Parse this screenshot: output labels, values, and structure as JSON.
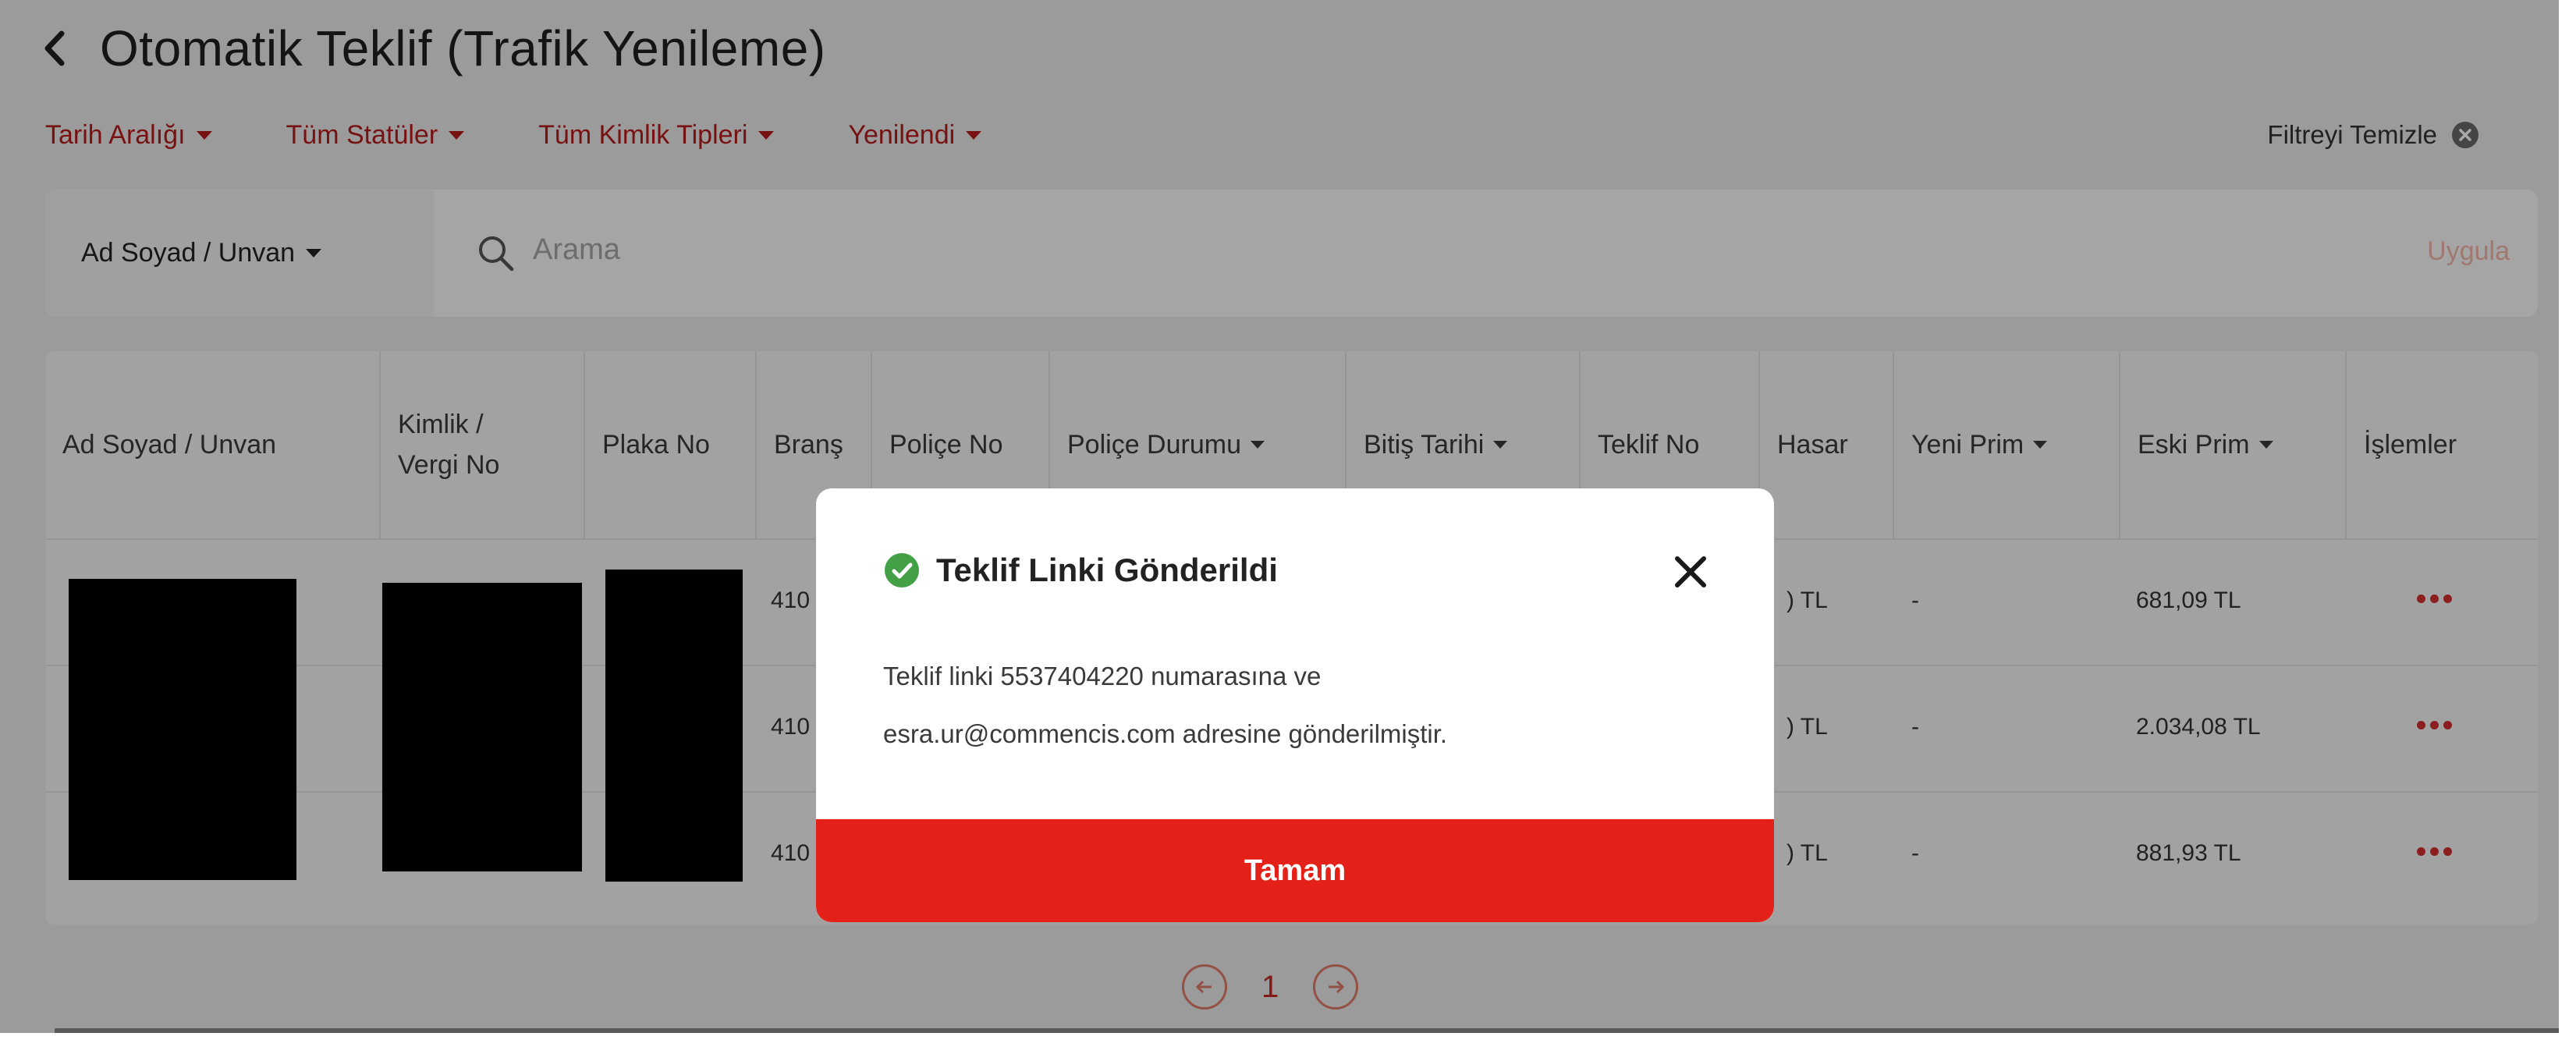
{
  "header": {
    "title": "Otomatik Teklif (Trafik Yenileme)"
  },
  "filters": {
    "items": [
      "Tarih Aralığı",
      "Tüm Statüler",
      "Tüm Kimlik Tipleri",
      "Yenilendi"
    ],
    "clear_label": "Filtreyi Temizle"
  },
  "search": {
    "field_select": "Ad Soyad / Unvan",
    "placeholder": "Arama",
    "apply_label": "Uygula"
  },
  "table": {
    "columns": [
      {
        "label": "Ad Soyad / Unvan",
        "sortable": false
      },
      {
        "label": "Kimlik /\nVergi No",
        "sortable": false
      },
      {
        "label": "Plaka No",
        "sortable": false
      },
      {
        "label": "Branş",
        "sortable": false
      },
      {
        "label": "Poliçe No",
        "sortable": false
      },
      {
        "label": "Poliçe Durumu",
        "sortable": true
      },
      {
        "label": "Bitiş Tarihi",
        "sortable": true
      },
      {
        "label": "Teklif No",
        "sortable": false
      },
      {
        "label": "Hasar",
        "sortable": false
      },
      {
        "label": "Yeni Prim",
        "sortable": true
      },
      {
        "label": "Eski Prim",
        "sortable": true
      },
      {
        "label": "İşlemler",
        "sortable": false
      }
    ],
    "rows": [
      {
        "brans": "410",
        "hasar": ") TL",
        "yeni_prim": "-",
        "eski_prim": "681,09 TL"
      },
      {
        "brans": "410",
        "hasar": ") TL",
        "yeni_prim": "-",
        "eski_prim": "2.034,08 TL"
      },
      {
        "brans": "410",
        "hasar": ") TL",
        "yeni_prim": "-",
        "eski_prim": "881,93 TL"
      }
    ]
  },
  "pagination": {
    "current_page": "1"
  },
  "modal": {
    "title": "Teklif Linki Gönderildi",
    "line1": "Teklif linki 5537404220 numarasına ve",
    "line2": "esra.ur@commencis.com adresine gönderilmiştir.",
    "confirm_label": "Tamam"
  },
  "colors": {
    "accent_red": "#e32119",
    "filter_red": "#b71c1c",
    "success_green": "#43a047"
  }
}
